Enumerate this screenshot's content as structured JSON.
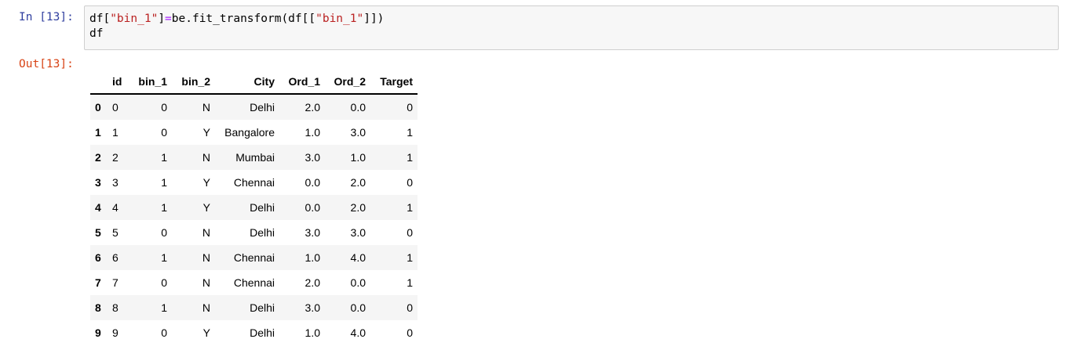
{
  "input_prompt": "In [13]:",
  "output_prompt": "Out[13]:",
  "code": {
    "line1": {
      "p1": "df[",
      "s1": "\"bin_1\"",
      "p2": "]",
      "op": "=",
      "p3": "be.fit_transform(df[[",
      "s2": "\"bin_1\"",
      "p4": "]])"
    },
    "line2": "df"
  },
  "table": {
    "columns": [
      "",
      "id",
      "bin_1",
      "bin_2",
      "City",
      "Ord_1",
      "Ord_2",
      "Target"
    ],
    "rows": [
      [
        "0",
        "0",
        "0",
        "N",
        "Delhi",
        "2.0",
        "0.0",
        "0"
      ],
      [
        "1",
        "1",
        "0",
        "Y",
        "Bangalore",
        "1.0",
        "3.0",
        "1"
      ],
      [
        "2",
        "2",
        "1",
        "N",
        "Mumbai",
        "3.0",
        "1.0",
        "1"
      ],
      [
        "3",
        "3",
        "1",
        "Y",
        "Chennai",
        "0.0",
        "2.0",
        "0"
      ],
      [
        "4",
        "4",
        "1",
        "Y",
        "Delhi",
        "0.0",
        "2.0",
        "1"
      ],
      [
        "5",
        "5",
        "0",
        "N",
        "Delhi",
        "3.0",
        "3.0",
        "0"
      ],
      [
        "6",
        "6",
        "1",
        "N",
        "Chennai",
        "1.0",
        "4.0",
        "1"
      ],
      [
        "7",
        "7",
        "0",
        "N",
        "Chennai",
        "2.0",
        "0.0",
        "1"
      ],
      [
        "8",
        "8",
        "1",
        "N",
        "Delhi",
        "3.0",
        "0.0",
        "0"
      ],
      [
        "9",
        "9",
        "0",
        "Y",
        "Delhi",
        "1.0",
        "4.0",
        "0"
      ]
    ]
  },
  "colors": {
    "input_prompt": "#303f9f",
    "output_prompt": "#d84315",
    "string": "#ba2121",
    "operator": "#aa22ff"
  }
}
